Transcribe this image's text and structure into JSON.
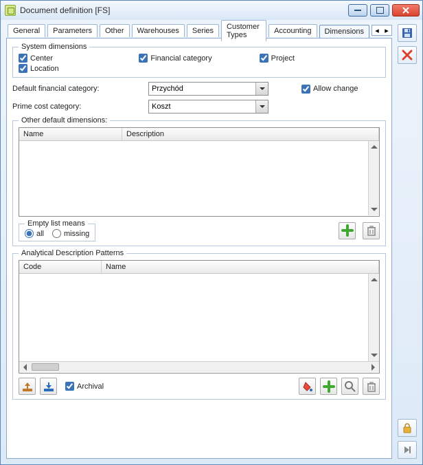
{
  "window": {
    "title": "Document definition [FS]"
  },
  "tabs": [
    "General",
    "Parameters",
    "Other",
    "Warehouses",
    "Series",
    "Customer Types",
    "Accounting",
    "Dimensions"
  ],
  "active_tab": 7,
  "sys": {
    "legend": "System dimensions",
    "center": "Center",
    "location": "Location",
    "fincat": "Financial category",
    "project": "Project",
    "center_checked": true,
    "location_checked": true,
    "fincat_checked": true,
    "project_checked": true
  },
  "form": {
    "fincat_label": "Default financial category:",
    "fincat_value": "Przychód",
    "prime_label": "Prime cost category:",
    "prime_value": "Koszt",
    "allow_label": "Allow change",
    "allow_checked": true
  },
  "other": {
    "legend": "Other default dimensions:",
    "col_name": "Name",
    "col_desc": "Description",
    "empty_legend": "Empty list means",
    "opt_all": "all",
    "opt_missing": "missing"
  },
  "analytic": {
    "legend": "Analytical Description Patterns",
    "col_code": "Code",
    "col_name": "Name",
    "archival": "Archival",
    "archival_checked": true
  }
}
